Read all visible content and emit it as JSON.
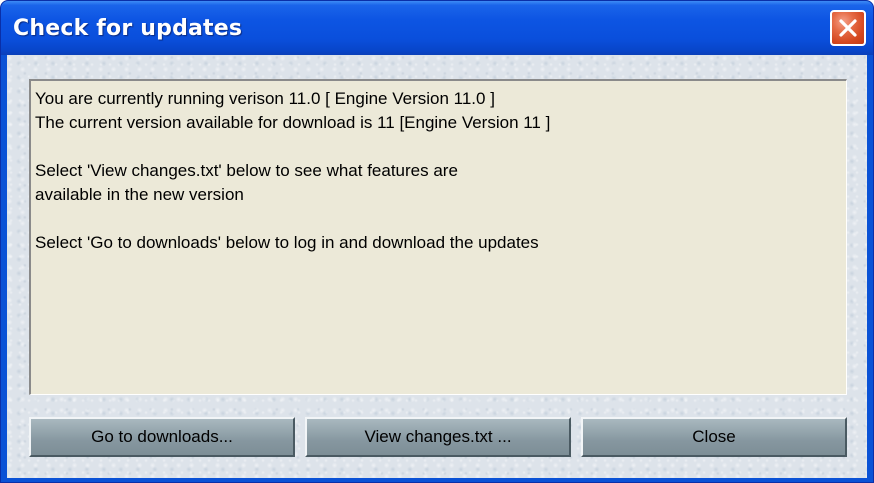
{
  "window": {
    "title": "Check for updates",
    "close_icon": "close-x-icon"
  },
  "message": {
    "lines": [
      "You are currently running verison 11.0 [ Engine Version 11.0 ]",
      "The current version available for download is 11 [Engine Version 11 ]",
      "",
      "Select 'View changes.txt' below to see what features are",
      "available in the new version",
      "",
      "Select 'Go to downloads' below to log in and download the updates"
    ]
  },
  "buttons": {
    "go_to_downloads": "Go to downloads...",
    "view_changes": "View changes.txt ...",
    "close": "Close"
  },
  "colors": {
    "titlebar_blue": "#0a4fdc",
    "close_red": "#d4471f",
    "text_area_bg": "#ece9d8",
    "button_face": "#8fa0a8"
  }
}
